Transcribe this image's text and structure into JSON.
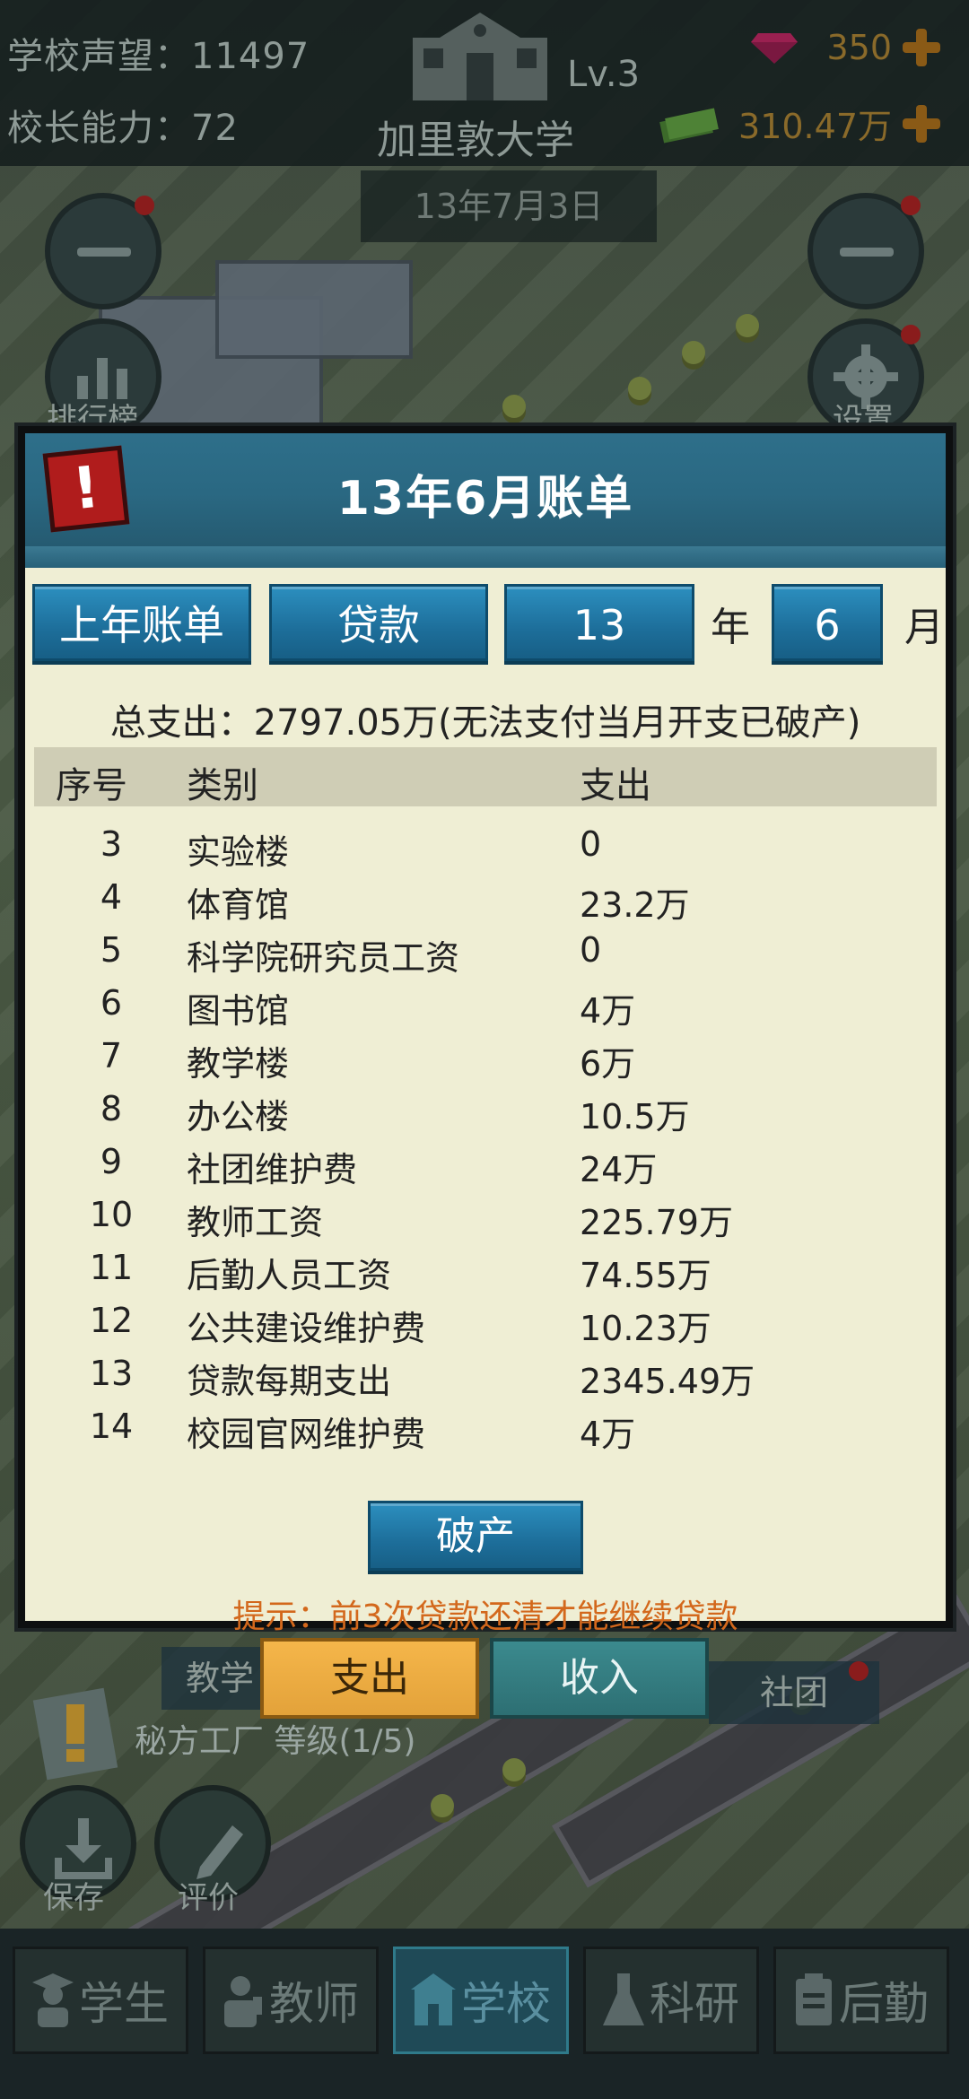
{
  "header": {
    "reputation_label": "学校声望：11497",
    "ability_label": "校长能力：72",
    "school_name": "加里敦大学",
    "school_level": "Lv.3",
    "gems": "350",
    "money": "310.47万",
    "date": "13年7月3日"
  },
  "side": {
    "rank_label": "排行榜",
    "settings_label": "设置"
  },
  "modal": {
    "title": "13年6月账单",
    "prev_year_button": "上年账单",
    "loan_button": "贷款",
    "year_value": "13",
    "year_unit": "年",
    "month_value": "6",
    "month_unit": "月",
    "total": "总支出：2797.05万(无法支付当月开支已破产)",
    "columns": {
      "no": "序号",
      "category": "类别",
      "amount": "支出"
    },
    "rows": [
      {
        "no": "3",
        "category": "实验楼",
        "amount": "0"
      },
      {
        "no": "4",
        "category": "体育馆",
        "amount": "23.2万"
      },
      {
        "no": "5",
        "category": "科学院研究员工资",
        "amount": "0"
      },
      {
        "no": "6",
        "category": "图书馆",
        "amount": "4万"
      },
      {
        "no": "7",
        "category": "教学楼",
        "amount": "6万"
      },
      {
        "no": "8",
        "category": "办公楼",
        "amount": "10.5万"
      },
      {
        "no": "9",
        "category": "社团维护费",
        "amount": "24万"
      },
      {
        "no": "10",
        "category": "教师工资",
        "amount": "225.79万"
      },
      {
        "no": "11",
        "category": "后勤人员工资",
        "amount": "74.55万"
      },
      {
        "no": "12",
        "category": "公共建设维护费",
        "amount": "10.23万"
      },
      {
        "no": "13",
        "category": "贷款每期支出",
        "amount": "2345.49万"
      },
      {
        "no": "14",
        "category": "校园官网维护费",
        "amount": "4万"
      }
    ],
    "bankrupt_button": "破产",
    "tip": "提示：前3次贷款还清才能继续贷款"
  },
  "tabs": {
    "expense": "支出",
    "income": "收入",
    "left_bg": "教学",
    "right_bg": "社团"
  },
  "factory": "秘方工厂 等级(1/5)",
  "actions": {
    "save": "保存",
    "review": "评价"
  },
  "nav": {
    "items": [
      "学生",
      "教师",
      "学校",
      "科研",
      "后勤"
    ],
    "active": "学校"
  },
  "colors": {
    "modal_header": "#2a6882",
    "modal_body": "#efeed4",
    "button_blue": "#1d6e9a",
    "tip_orange": "#d3681c",
    "expense_tab": "#f5b64a",
    "income_tab": "#2d6f73"
  }
}
